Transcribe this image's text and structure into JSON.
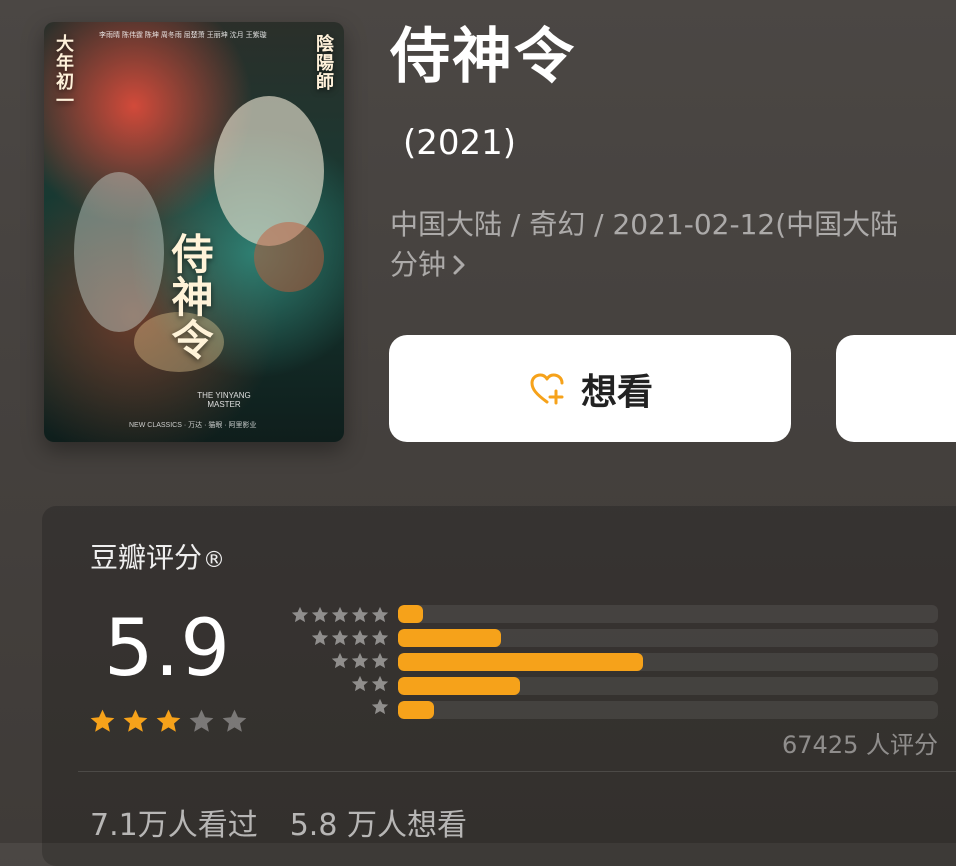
{
  "movie": {
    "title": "侍神令",
    "year": "(2021)",
    "meta_line1": "中国大陆 / 奇幻 / 2021-02-12(中国大陆",
    "meta_line2": "分钟",
    "chevron_icon": "chevron-right-icon"
  },
  "poster": {
    "left_vertical": "大年初一",
    "right_vertical": "陰陽師",
    "main_calligraphy": "侍神令",
    "credits_line": "李雨晴 陈伟霆 陈坤 周冬雨 屈楚萧 王丽坤 沈月 王紫璇",
    "english_title": "THE YINYANG MASTER",
    "logos": "NEW CLASSICS · 万达 · 猫眼 · 阿里影业"
  },
  "actions": {
    "want_to_watch_label": "想看",
    "want_icon": "heart-plus-icon",
    "accent": "#f6a21a"
  },
  "rating": {
    "section_title": "豆瓣评分",
    "registered_mark": "®",
    "score": "5.9",
    "stars_filled": 3,
    "stars_total": 5,
    "distribution_percent": [
      4.6,
      19.1,
      45.4,
      22.6,
      6.6
    ],
    "count_text": "67425 人评分"
  },
  "stats": {
    "seen": "7.1万人看过",
    "want": "5.8 万人想看"
  }
}
